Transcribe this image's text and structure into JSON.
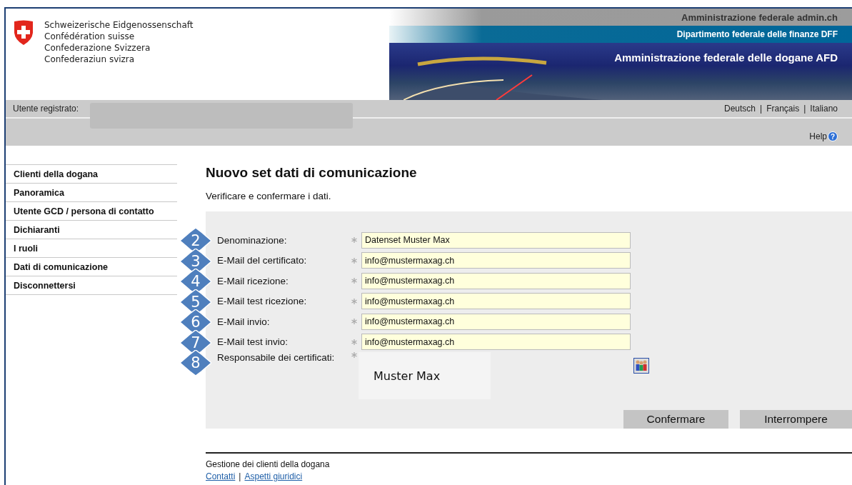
{
  "header": {
    "coat_lines": [
      "Schweizerische Eidgenossenschaft",
      "Confédération suisse",
      "Confederazione Svizzera",
      "Confederaziun svizra"
    ],
    "admin": "Amministrazione federale admin.ch",
    "department": "Dipartimento federale delle finanze DFF",
    "office": "Amministrazione federale delle dogane AFD"
  },
  "user_bar": {
    "label": "Utente registrato:",
    "languages": [
      "Deutsch",
      "Français",
      "Italiano"
    ],
    "separator": "|",
    "help": "Help",
    "help_icon": "?"
  },
  "sidebar": {
    "items": [
      "Clienti della dogana",
      "Panoramica",
      "Utente GCD / persona di contatto",
      "Dichiaranti",
      "I ruoli",
      "Dati di comunicazione",
      "Disconnettersi"
    ]
  },
  "page": {
    "title": "Nuovo set dati di comunicazione",
    "subtitle": "Verificare e confermare i dati."
  },
  "form": {
    "fields": [
      {
        "badge": "2",
        "label": "Denominazione:",
        "required": true,
        "value": "Datenset Muster Max"
      },
      {
        "badge": "3",
        "label": "E-Mail del certificato:",
        "required": true,
        "value": "info@mustermaxag.ch"
      },
      {
        "badge": "4",
        "label": "E-Mail ricezione:",
        "required": true,
        "value": "info@mustermaxag.ch"
      },
      {
        "badge": "5",
        "label": "E-Mail test ricezione:",
        "required": true,
        "value": "info@mustermaxag.ch"
      },
      {
        "badge": "6",
        "label": "E-Mail invio:",
        "required": true,
        "value": "info@mustermaxag.ch"
      },
      {
        "badge": "7",
        "label": "E-Mail test invio:",
        "required": true,
        "value": "info@mustermaxag.ch"
      }
    ],
    "responsible": {
      "badge": "8",
      "label": "Responsabile dei certificati:",
      "required": true,
      "value": "Muster Max"
    },
    "buttons": [
      "Confermare",
      "Interrompere"
    ]
  },
  "footer": {
    "text": "Gestione dei clienti della dogana",
    "links": [
      "Contatti",
      "Aspetti giuridici"
    ],
    "separator": "|"
  }
}
